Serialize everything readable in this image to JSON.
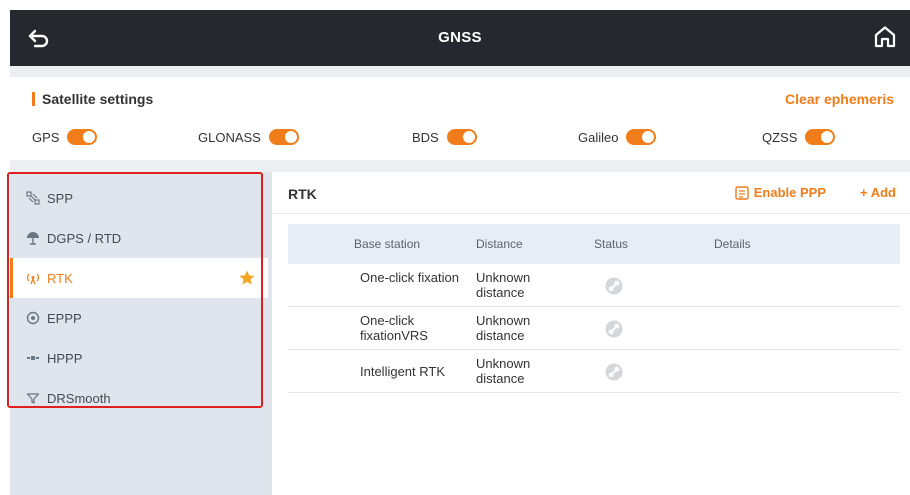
{
  "header": {
    "title": "GNSS"
  },
  "satellite_settings": {
    "title": "Satellite settings",
    "clear_label": "Clear ephemeris",
    "systems": [
      {
        "label": "GPS",
        "enabled": true
      },
      {
        "label": "GLONASS",
        "enabled": true
      },
      {
        "label": "BDS",
        "enabled": true
      },
      {
        "label": "Galileo",
        "enabled": true
      },
      {
        "label": "QZSS",
        "enabled": true
      }
    ]
  },
  "menu": {
    "items": [
      {
        "label": "SPP",
        "icon": "satellite-icon"
      },
      {
        "label": "DGPS / RTD",
        "icon": "antenna-icon"
      },
      {
        "label": "RTK",
        "icon": "signal-tower-icon",
        "active": true,
        "favorite": true
      },
      {
        "label": "EPPP",
        "icon": "globe-icon"
      },
      {
        "label": "HPPP",
        "icon": "satellite-wave-icon"
      },
      {
        "label": "DRSmooth",
        "icon": "funnel-icon"
      }
    ]
  },
  "main": {
    "title": "RTK",
    "enable_ppp_label": "Enable PPP",
    "add_label": "+ Add",
    "columns": [
      "Base station",
      "Distance",
      "Status",
      "Details"
    ],
    "rows": [
      {
        "base_station": "One-click fixation",
        "distance": "Unknown distance",
        "status": "disconnected"
      },
      {
        "base_station": "One-click fixationVRS",
        "distance": "Unknown distance",
        "status": "disconnected"
      },
      {
        "base_station": "Intelligent RTK",
        "distance": "Unknown distance",
        "status": "disconnected"
      }
    ]
  },
  "colors": {
    "accent": "#f07d1a",
    "header_bg": "#25292f",
    "highlight": "#e02020"
  }
}
